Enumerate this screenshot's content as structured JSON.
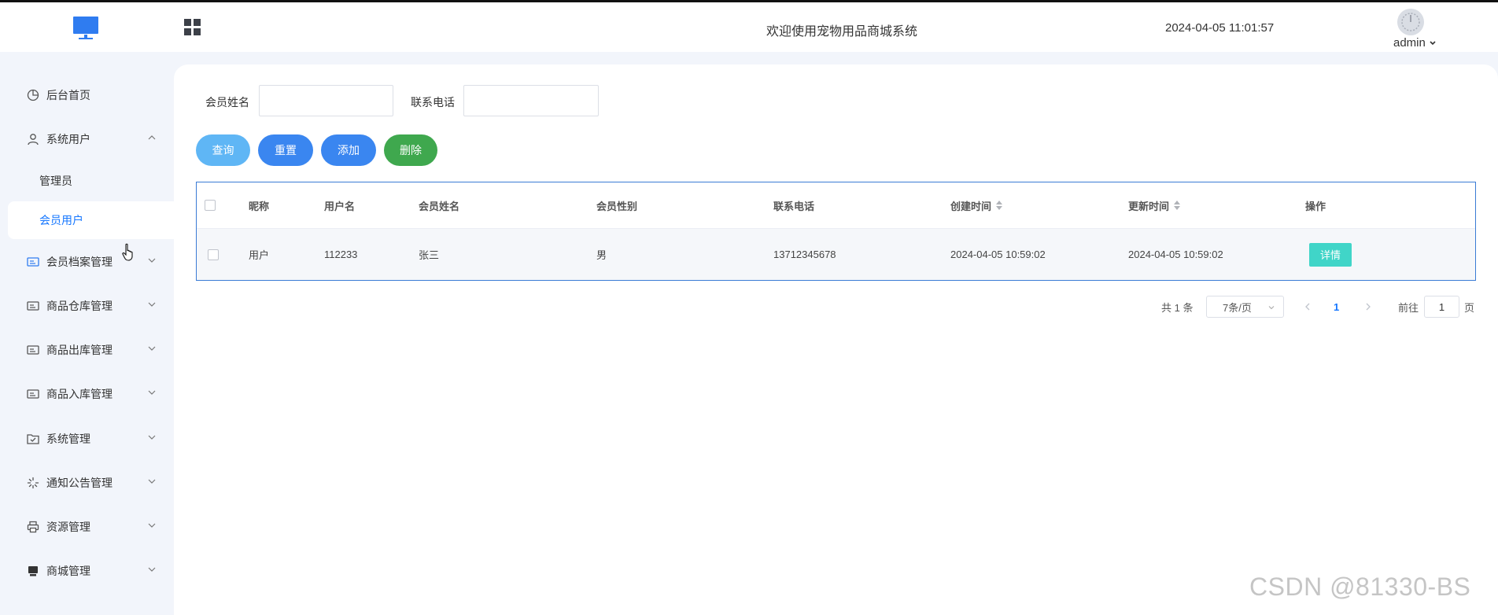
{
  "header": {
    "title": "欢迎使用宠物用品商城系统",
    "datetime": "2024-04-05 11:01:57",
    "user": "admin"
  },
  "sidebar": {
    "items": [
      {
        "label": "后台首页",
        "icon": "pie-chart-icon"
      },
      {
        "label": "系统用户",
        "icon": "user-icon",
        "expanded": true,
        "children": [
          {
            "label": "管理员"
          },
          {
            "label": "会员用户",
            "active": true
          }
        ]
      },
      {
        "label": "会员档案管理",
        "icon": "id-card-icon"
      },
      {
        "label": "商品仓库管理",
        "icon": "id-card-icon"
      },
      {
        "label": "商品出库管理",
        "icon": "id-card-icon"
      },
      {
        "label": "商品入库管理",
        "icon": "id-card-icon"
      },
      {
        "label": "系统管理",
        "icon": "folder-check-icon"
      },
      {
        "label": "通知公告管理",
        "icon": "loading-icon"
      },
      {
        "label": "资源管理",
        "icon": "printer-icon"
      },
      {
        "label": "商城管理",
        "icon": "monitor-icon"
      }
    ]
  },
  "search": {
    "name_label": "会员姓名",
    "name_value": "",
    "phone_label": "联系电话",
    "phone_value": ""
  },
  "buttons": {
    "query": "查询",
    "reset": "重置",
    "add": "添加",
    "delete": "删除"
  },
  "table": {
    "columns": [
      "昵称",
      "用户名",
      "会员姓名",
      "会员性别",
      "联系电话",
      "创建时间",
      "更新时间",
      "操作"
    ],
    "rows": [
      {
        "nickname": "用户",
        "username": "112233",
        "name": "张三",
        "gender": "男",
        "phone": "13712345678",
        "created": "2024-04-05 10:59:02",
        "updated": "2024-04-05 10:59:02",
        "action": "详情"
      }
    ]
  },
  "pagination": {
    "total": "共 1 条",
    "page_size": "7条/页",
    "current_page": "1",
    "goto_label": "前往",
    "goto_value": "1",
    "page_suffix": "页"
  },
  "colors": {
    "query": "#5fb6f5",
    "reset": "#3a86f0",
    "add": "#3a86f0",
    "delete": "#3fa84e",
    "detail": "#40d5c8",
    "accent": "#1677ff"
  },
  "watermark": "CSDN @81330-BS"
}
